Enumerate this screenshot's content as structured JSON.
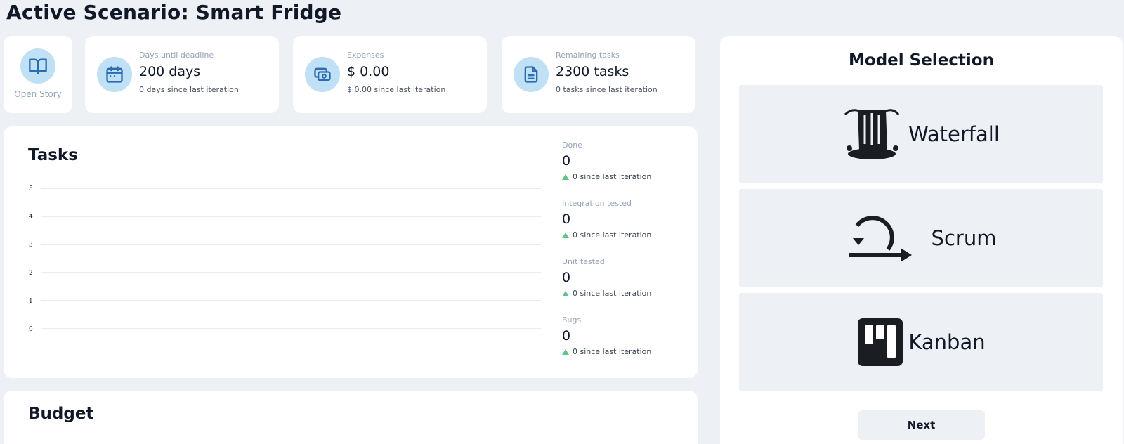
{
  "page": {
    "title": "Active Scenario: Smart Fridge"
  },
  "story": {
    "label": "Open Story",
    "icon": "book-open-icon"
  },
  "stats": [
    {
      "icon": "calendar-icon",
      "label": "Days until deadline",
      "value": "200 days",
      "delta": "0 days since last iteration"
    },
    {
      "icon": "money-icon",
      "label": "Expenses",
      "value": "$ 0.00",
      "delta": "$ 0.00 since last iteration"
    },
    {
      "icon": "document-icon",
      "label": "Remaining tasks",
      "value": "2300 tasks",
      "delta": "0 tasks since last iteration"
    }
  ],
  "tasks": {
    "title": "Tasks",
    "stats": [
      {
        "label": "Done",
        "value": "0",
        "delta": "0 since last iteration"
      },
      {
        "label": "Integration tested",
        "value": "0",
        "delta": "0 since last iteration"
      },
      {
        "label": "Unit tested",
        "value": "0",
        "delta": "0 since last iteration"
      },
      {
        "label": "Bugs",
        "value": "0",
        "delta": "0 since last iteration"
      }
    ]
  },
  "chart_data": {
    "type": "line",
    "title": "",
    "xlabel": "",
    "ylabel": "",
    "ylim": [
      0,
      5
    ],
    "yticks": [
      "0",
      "1",
      "2",
      "3",
      "4",
      "5"
    ],
    "grid": true,
    "series": []
  },
  "budget": {
    "title": "Budget"
  },
  "model_selection": {
    "title": "Model Selection",
    "options": [
      {
        "label": "Waterfall",
        "icon": "waterfall-icon"
      },
      {
        "label": "Scrum",
        "icon": "scrum-cycle-icon"
      },
      {
        "label": "Kanban",
        "icon": "kanban-board-icon"
      }
    ],
    "next_label": "Next"
  },
  "colors": {
    "background": "#edf1f6",
    "card": "#ffffff",
    "icon_circle": "#bfe0f5",
    "icon_stroke": "#2b6cb0",
    "delta_up": "#5dc48a"
  }
}
